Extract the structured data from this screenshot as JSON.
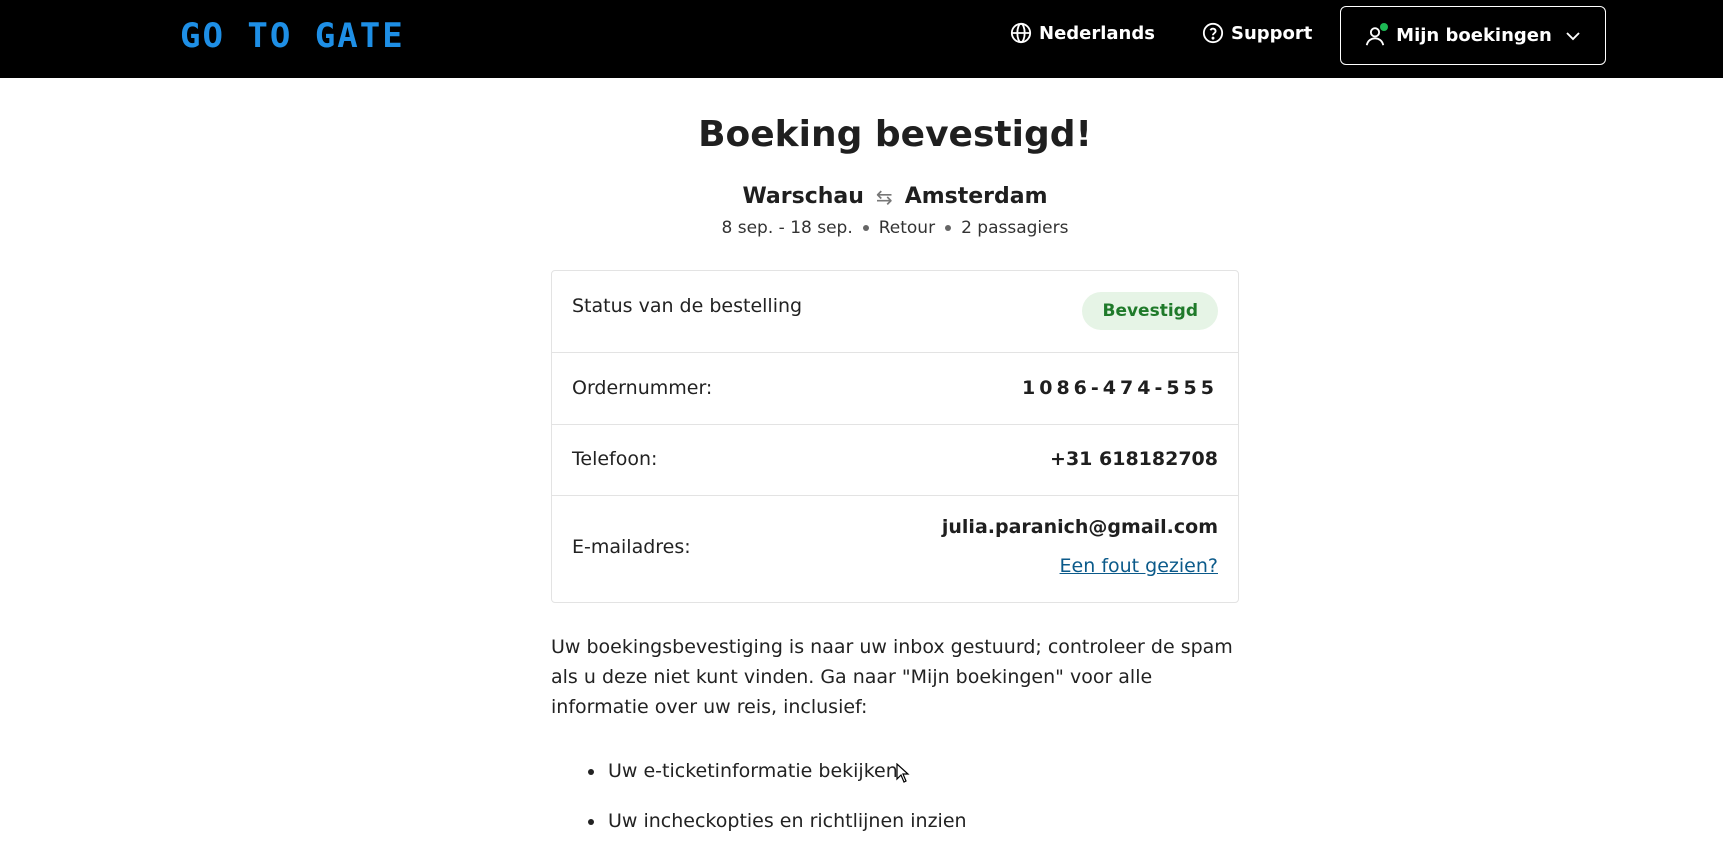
{
  "header": {
    "logo_text": "GO TO GATE",
    "language_label": "Nederlands",
    "support_label": "Support",
    "bookings_label": "Mijn boekingen",
    "colors": {
      "background": "#000000",
      "logo": "#1e8fe6",
      "notification_dot": "#1db954"
    }
  },
  "main": {
    "title": "Boeking bevestigd!",
    "route": {
      "origin": "Warschau",
      "destination": "Amsterdam"
    },
    "trip": {
      "dates": "8 sep. - 18 sep.",
      "type": "Retour",
      "passengers": "2 passagiers"
    }
  },
  "card": {
    "status_label": "Status van de bestelling",
    "status_value": "Bevestigd",
    "order_label": "Ordernummer:",
    "order_value": "1086-474-555",
    "phone_label": "Telefoon:",
    "phone_value": "+31 618182708",
    "email_label": "E-mailadres:",
    "email_value": "julia.paranich@gmail.com",
    "error_link": "Een fout gezien?",
    "colors": {
      "badge_bg": "#e6f4e6",
      "badge_text": "#1f7a2a",
      "link": "#0b5a8a"
    }
  },
  "info_text": "Uw boekingsbevestiging is naar uw inbox gestuurd; controleer de spam als u deze niet kunt vinden. Ga naar \"Mijn boekingen\" voor alle informatie over uw reis, inclusief:",
  "bullets": [
    "Uw e-ticketinformatie bekijken",
    "Uw incheckopties en richtlijnen inzien"
  ]
}
